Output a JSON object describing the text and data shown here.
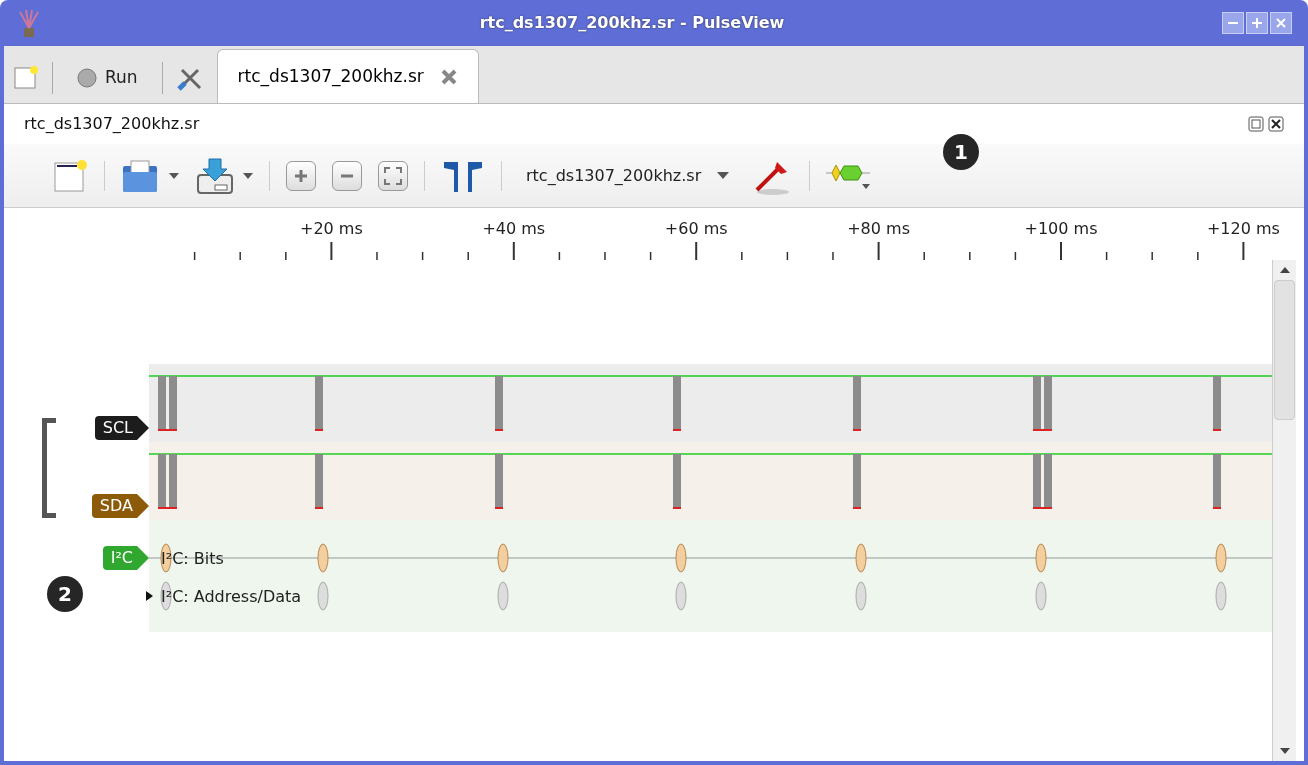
{
  "window": {
    "title": "rtc_ds1307_200khz.sr - PulseView"
  },
  "main_toolbar": {
    "run_label": "Run"
  },
  "session_tabs": [
    {
      "label": "rtc_ds1307_200khz.sr",
      "selected": true
    }
  ],
  "session_title": "rtc_ds1307_200khz.sr",
  "device_selector": {
    "value": "rtc_ds1307_200khz.sr"
  },
  "ruler": {
    "labels": [
      "+20 ms",
      "+40 ms",
      "+60 ms",
      "+80 ms",
      "+100 ms",
      "+120 ms"
    ]
  },
  "channels": [
    {
      "name": "SCL",
      "kind": "logic",
      "color": "#1c1c1c"
    },
    {
      "name": "SDA",
      "kind": "logic",
      "color": "#8c5a08"
    },
    {
      "name": "I²C",
      "kind": "decoder",
      "color": "#30a830",
      "rows": [
        "I²C: Bits",
        "I²C: Address/Data"
      ]
    }
  ],
  "callouts": [
    "1",
    "2"
  ]
}
